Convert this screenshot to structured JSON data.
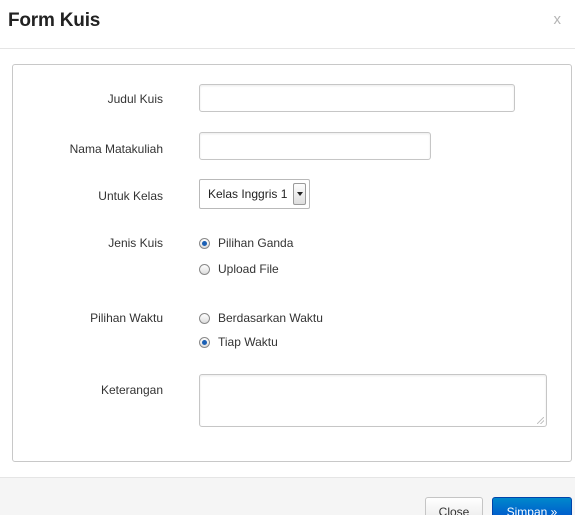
{
  "modal": {
    "title": "Form Kuis",
    "close_symbol": "x"
  },
  "form": {
    "judul": {
      "label": "Judul Kuis",
      "value": ""
    },
    "matakuliah": {
      "label": "Nama Matakuliah",
      "value": ""
    },
    "kelas": {
      "label": "Untuk Kelas",
      "selected": "Kelas Inggris 1"
    },
    "jenis": {
      "label": "Jenis Kuis",
      "options": [
        {
          "label": "Pilihan Ganda",
          "checked": true
        },
        {
          "label": "Upload File",
          "checked": false
        }
      ]
    },
    "waktu": {
      "label": "Pilihan Waktu",
      "options": [
        {
          "label": "Berdasarkan Waktu",
          "checked": false
        },
        {
          "label": "Tiap Waktu",
          "checked": true
        }
      ]
    },
    "keterangan": {
      "label": "Keterangan",
      "value": ""
    }
  },
  "footer": {
    "close_label": "Close",
    "save_label": "Simpan »"
  },
  "colors": {
    "primary_button": "#0055cc",
    "radio_dot": "#1a5fb4",
    "border": "#c8c8c8"
  }
}
